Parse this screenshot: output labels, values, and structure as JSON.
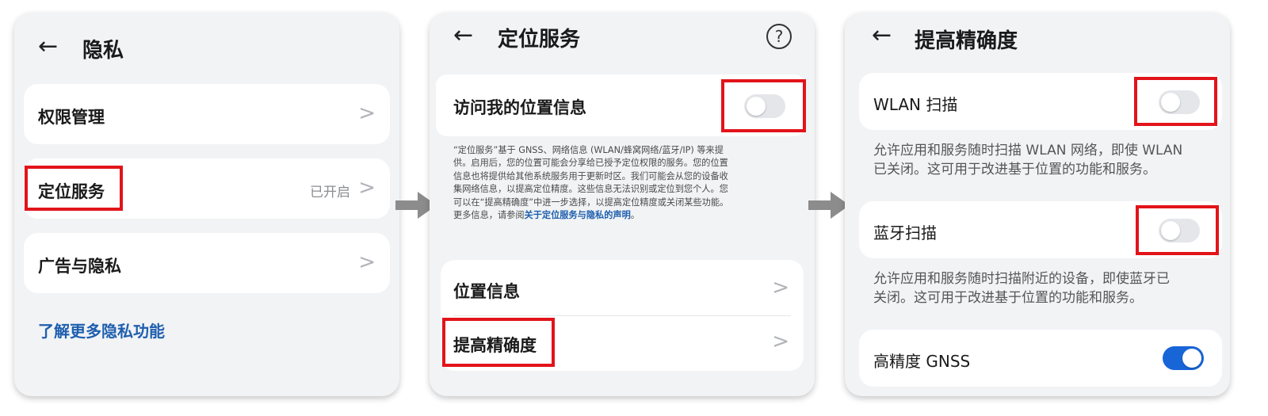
{
  "privacy": {
    "back_glyph": "←",
    "title": "隐私",
    "items": [
      {
        "label": "权限管理",
        "status": ""
      },
      {
        "label": "定位服务",
        "status": "已开启"
      },
      {
        "label": "广告与隐私",
        "status": ""
      }
    ],
    "chevron": ">",
    "more_link": "了解更多隐私功能"
  },
  "location": {
    "back_glyph": "←",
    "title": "定位服务",
    "help_glyph": "?",
    "access_label": "访问我的位置信息",
    "access_on": false,
    "description_lines": [
      "“定位服务”基于 GNSS、网络信息 (WLAN/蜂窝网络/蓝牙/IP) 等来提",
      "供。启用后，您的位置可能会分享给已授予定位权限的服务。您的位置",
      "信息也将提供给其他系统服务用于更新时区。我们可能会从您的设备收",
      "集网络信息，以提高定位精度。这些信息无法识别或定位到您个人。您",
      "可以在“提高精确度”中进一步选择，以提高定位精度或关闭某些功能。"
    ],
    "description_last_prefix": "更多信息，请参阅",
    "description_link": "关于定位服务与隐私的声明",
    "description_last_suffix": "。",
    "items": [
      {
        "label": "位置信息"
      },
      {
        "label": "提高精确度"
      }
    ],
    "chevron": ">"
  },
  "accuracy": {
    "back_glyph": "←",
    "title": "提高精确度",
    "wlan_label": "WLAN 扫描",
    "wlan_on": false,
    "wlan_desc_lines": [
      "允许应用和服务随时扫描 WLAN 网络，即使 WLAN",
      "已关闭。这可用于改进基于位置的功能和服务。"
    ],
    "bt_label": "蓝牙扫描",
    "bt_on": false,
    "bt_desc_lines": [
      "允许应用和服务随时扫描附近的设备，即使蓝牙已",
      "关闭。这可用于改进基于位置的功能和服务。"
    ],
    "gnss_label": "高精度 GNSS",
    "gnss_on": true
  },
  "colors": {
    "highlight": "#e2141a",
    "link": "#1f5fae",
    "toggle_on": "#1865d8",
    "arrow": "#8c8c8c"
  }
}
